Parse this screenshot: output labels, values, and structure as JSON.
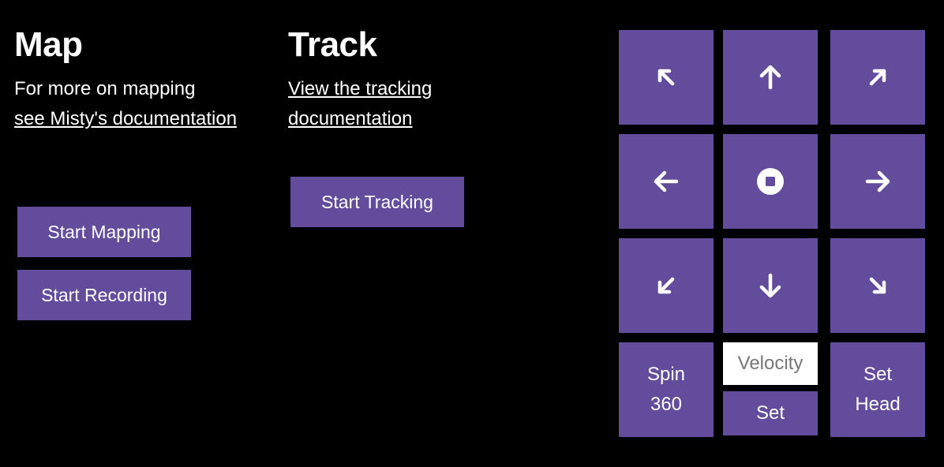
{
  "map": {
    "title": "Map",
    "text_prefix": "For more on mapping",
    "link_text": "see Misty's documentation",
    "start_mapping_label": "Start Mapping",
    "start_recording_label": "Start Recording"
  },
  "track": {
    "title": "Track",
    "link_text": "View the tracking documentation",
    "start_tracking_label": "Start Tracking"
  },
  "controls": {
    "icons": {
      "up_left": "arrow-up-left-icon",
      "up": "arrow-up-icon",
      "up_right": "arrow-up-right-icon",
      "left": "arrow-left-icon",
      "stop": "stop-icon",
      "right": "arrow-right-icon",
      "down_left": "arrow-down-left-icon",
      "down": "arrow-down-icon",
      "down_right": "arrow-down-right-icon"
    },
    "spin_label": "Spin\n360",
    "velocity_placeholder": "Velocity",
    "set_label": "Set",
    "set_head_label": "Set\nHead"
  },
  "colors": {
    "background": "#000000",
    "accent": "#634c9b",
    "text": "#ffffff",
    "input_bg": "#ffffff",
    "placeholder": "#777777"
  }
}
